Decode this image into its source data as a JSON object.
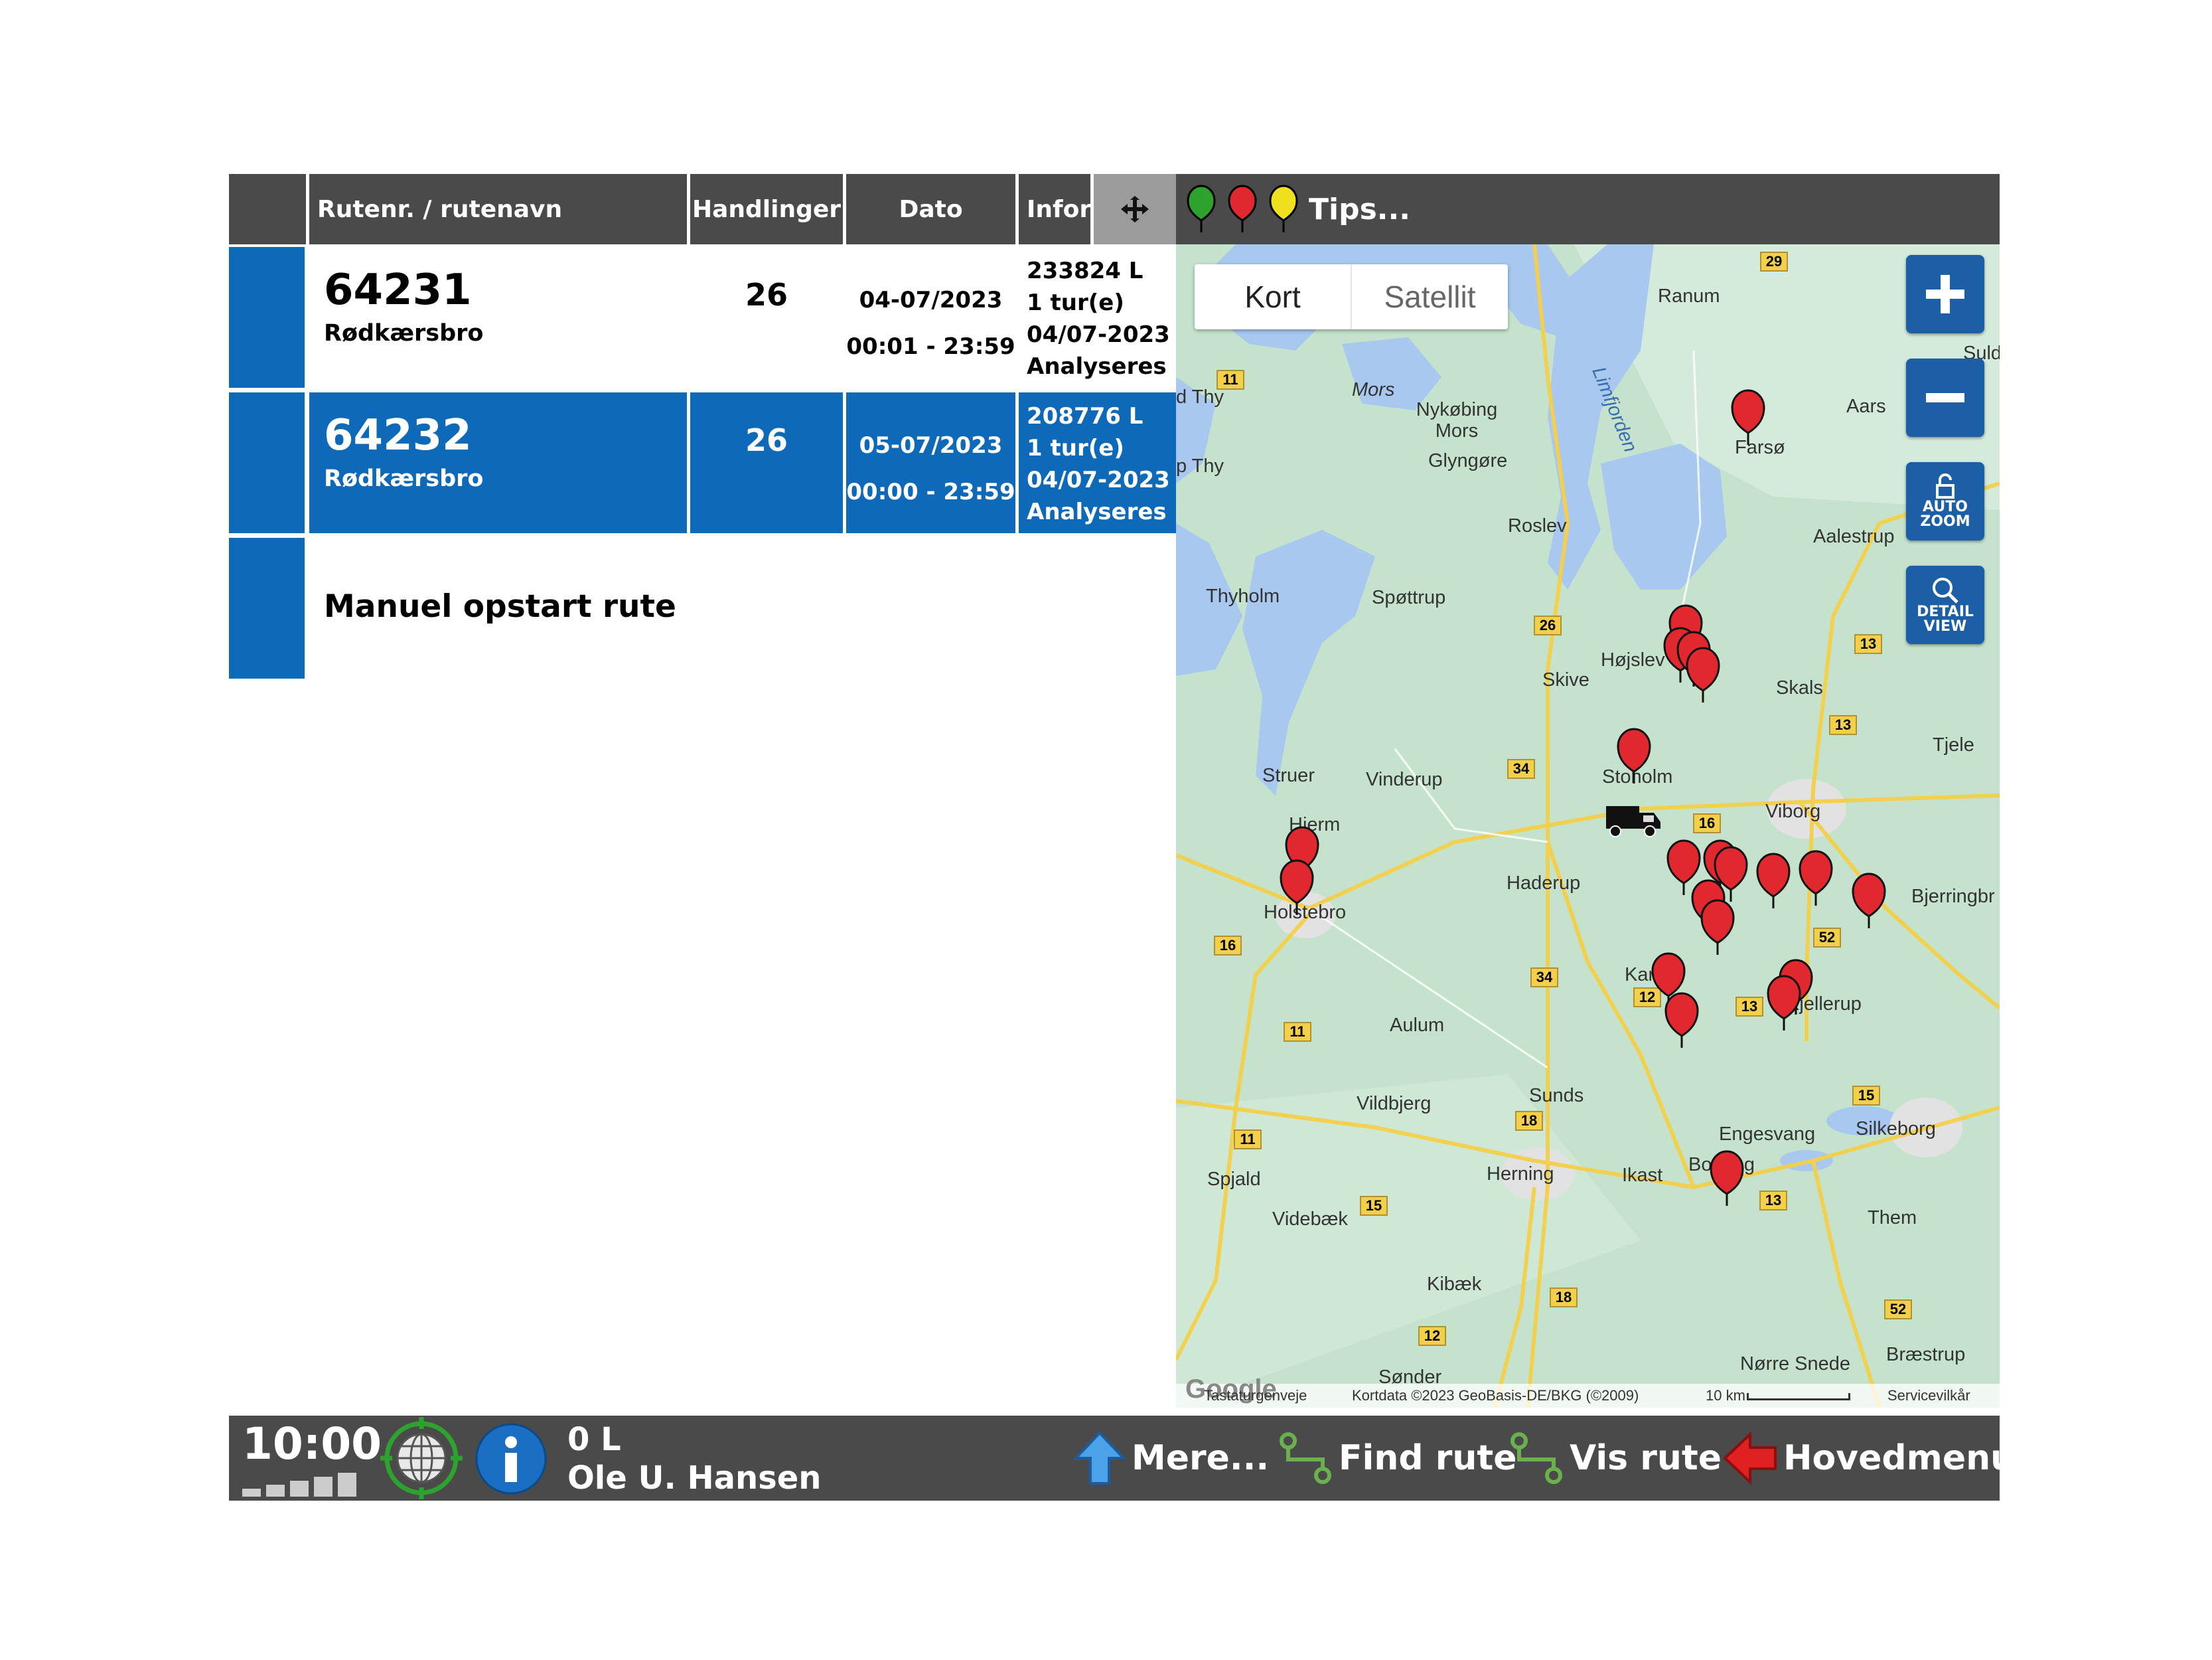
{
  "table": {
    "headers": {
      "route": "Rutenr. / rutenavn",
      "actions": "Handlinger",
      "date": "Dato",
      "info": "Infor"
    },
    "rows": [
      {
        "number": "64231",
        "name": "Rødkærsbro",
        "actions": "26",
        "date": "04-07/2023",
        "time": "00:01 - 23:59",
        "info": [
          "233824 L",
          "1 tur(e)",
          "04/07-2023",
          "Analyseres"
        ],
        "selected": false
      },
      {
        "number": "64232",
        "name": "Rødkærsbro",
        "actions": "26",
        "date": "05-07/2023",
        "time": "00:00 - 23:59",
        "info": [
          "208776 L",
          "1 tur(e)",
          "04/07-2023",
          "Analyseres"
        ],
        "selected": true
      }
    ],
    "manual_row": "Manuel opstart rute"
  },
  "map": {
    "tips_label": "Tips...",
    "map_type": {
      "map": "Kort",
      "satellite": "Satellit"
    },
    "buttons": {
      "auto_zoom": "AUTO ZOOM",
      "detail_view": "DETAIL VIEW"
    },
    "places": [
      "Ranum",
      "Farsø",
      "Aars",
      "Aalestrup",
      "Mors",
      "Nykøbing Mors",
      "Glyngøre",
      "Roslev",
      "Limfjorden",
      "d Thy",
      "p Thy",
      "Thyholm",
      "Spøttrup",
      "Højslev",
      "Skive",
      "Skals",
      "Tjele",
      "Struer",
      "Vinderup",
      "Stoholm",
      "Viborg",
      "Hjerm",
      "Holstebro",
      "Haderup",
      "Bjerringbr",
      "Aulum",
      "Karup",
      "Kjellerup",
      "Vildbjerg",
      "Sunds",
      "Engesvang",
      "Silkeborg",
      "Herning",
      "Ikast",
      "Bording",
      "Spjald",
      "Videbæk",
      "Them",
      "Kibæk",
      "Bræstrup",
      "Sønder",
      "Nørre Snede",
      "Suld"
    ],
    "roads": [
      "29",
      "11",
      "26",
      "13",
      "34",
      "16",
      "13",
      "52",
      "34",
      "12",
      "13",
      "15",
      "18",
      "15",
      "11",
      "11",
      "16",
      "13",
      "18",
      "12",
      "52"
    ],
    "attribution": {
      "shortcuts": "Tastaturgenveje",
      "data": "Kortdata ©2023 GeoBasis-DE/BKG (©2009)",
      "scale": "10 km",
      "terms": "Servicevilkår",
      "logo": "Google"
    },
    "marker_colors": {
      "green": "#2da32d",
      "red": "#e0282e",
      "yellow": "#f0e020"
    }
  },
  "bottom": {
    "clock": "10:00",
    "liters": "0 L",
    "driver": "Ole U. Hansen",
    "more": "Mere...",
    "find_route": "Find rute",
    "show_route": "Vis rute",
    "main_menu": "Hovedmenu"
  }
}
